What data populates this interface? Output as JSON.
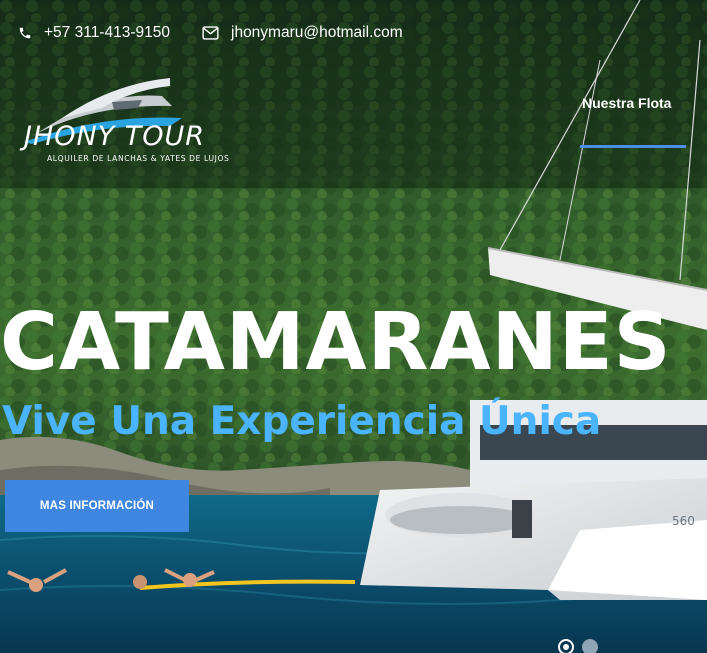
{
  "topbar": {
    "phone": "+57 311-413-9150",
    "phone_icon": "phone-icon",
    "email": "jhonymaru@hotmail.com",
    "email_icon": "envelope-icon"
  },
  "brand": {
    "name": "JHONY TOUR",
    "tagline": "ALQUILER DE LANCHAS & YATES DE LUJOS"
  },
  "nav": {
    "items": [
      {
        "label": "Nuestra Flota",
        "active": true
      }
    ]
  },
  "hero": {
    "title": "CATAMARANES",
    "subtitle": "Vive Una Experiencia Única",
    "cta_label": "MAS INFORMACIÓN",
    "slides_total": 2,
    "active_slide": 1
  },
  "colors": {
    "accent": "#3f86e0",
    "subtitle": "#4ab4ff",
    "nav_underline": "#4a8fe6"
  }
}
